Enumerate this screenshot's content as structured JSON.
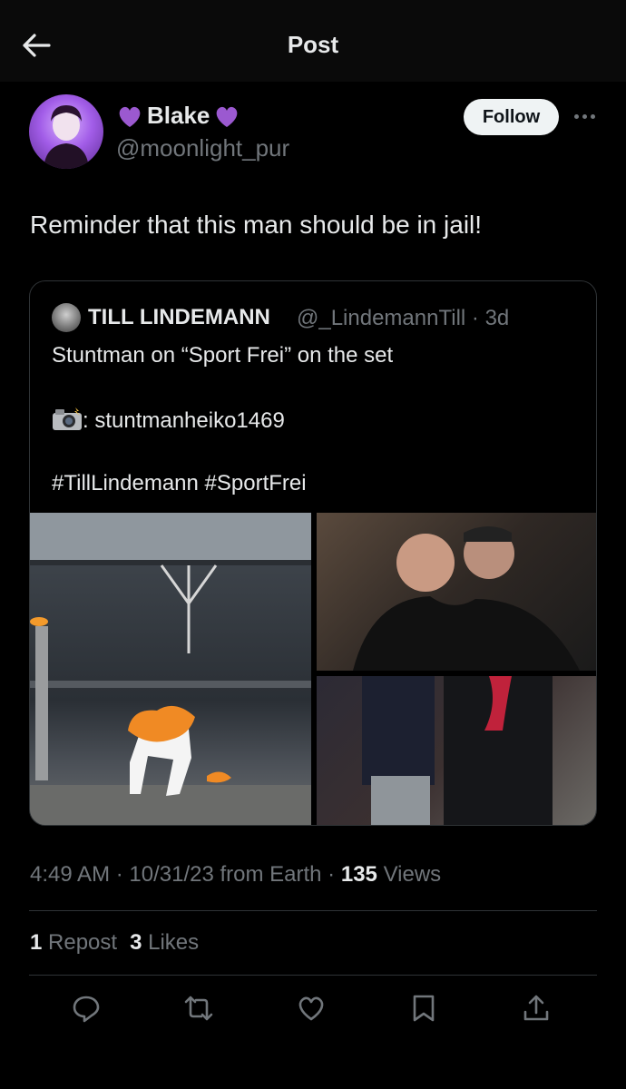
{
  "header": {
    "title": "Post",
    "back_icon": "arrow-left-icon"
  },
  "author": {
    "name": "Blake",
    "handle": "@moonlight_pur",
    "emoji_color": "#9b59d0",
    "follow_label": "Follow",
    "more_icon": "more-horizontal-icon"
  },
  "tweet": {
    "text": "Reminder that this man should be in jail!"
  },
  "quote": {
    "name": "TILL LINDEMANN",
    "handle": "@_LindemannTill · 3d",
    "line1": "Stuntman on “Sport Frei” on the set",
    "line2": ": stuntmanheiko1469",
    "line3": "#TillLindemann #SportFrei",
    "camera_icon": "camera-flash-icon",
    "images": [
      "stuntman-on-fire-in-stadium",
      "two-men-posing",
      "man-and-woman-posing"
    ]
  },
  "meta": {
    "time": "4:49 AM",
    "date": "10/31/23",
    "source": "from Earth",
    "views_count": "135",
    "views_label": "Views"
  },
  "stats": {
    "reposts_count": "1",
    "reposts_label": "Repost",
    "likes_count": "3",
    "likes_label": "Likes"
  },
  "actions": [
    "reply-icon",
    "repost-icon",
    "like-icon",
    "bookmark-icon",
    "share-icon"
  ],
  "colors": {
    "background": "#000000",
    "text": "#e7e9ea",
    "muted": "#71767b",
    "border": "#2f3336"
  }
}
